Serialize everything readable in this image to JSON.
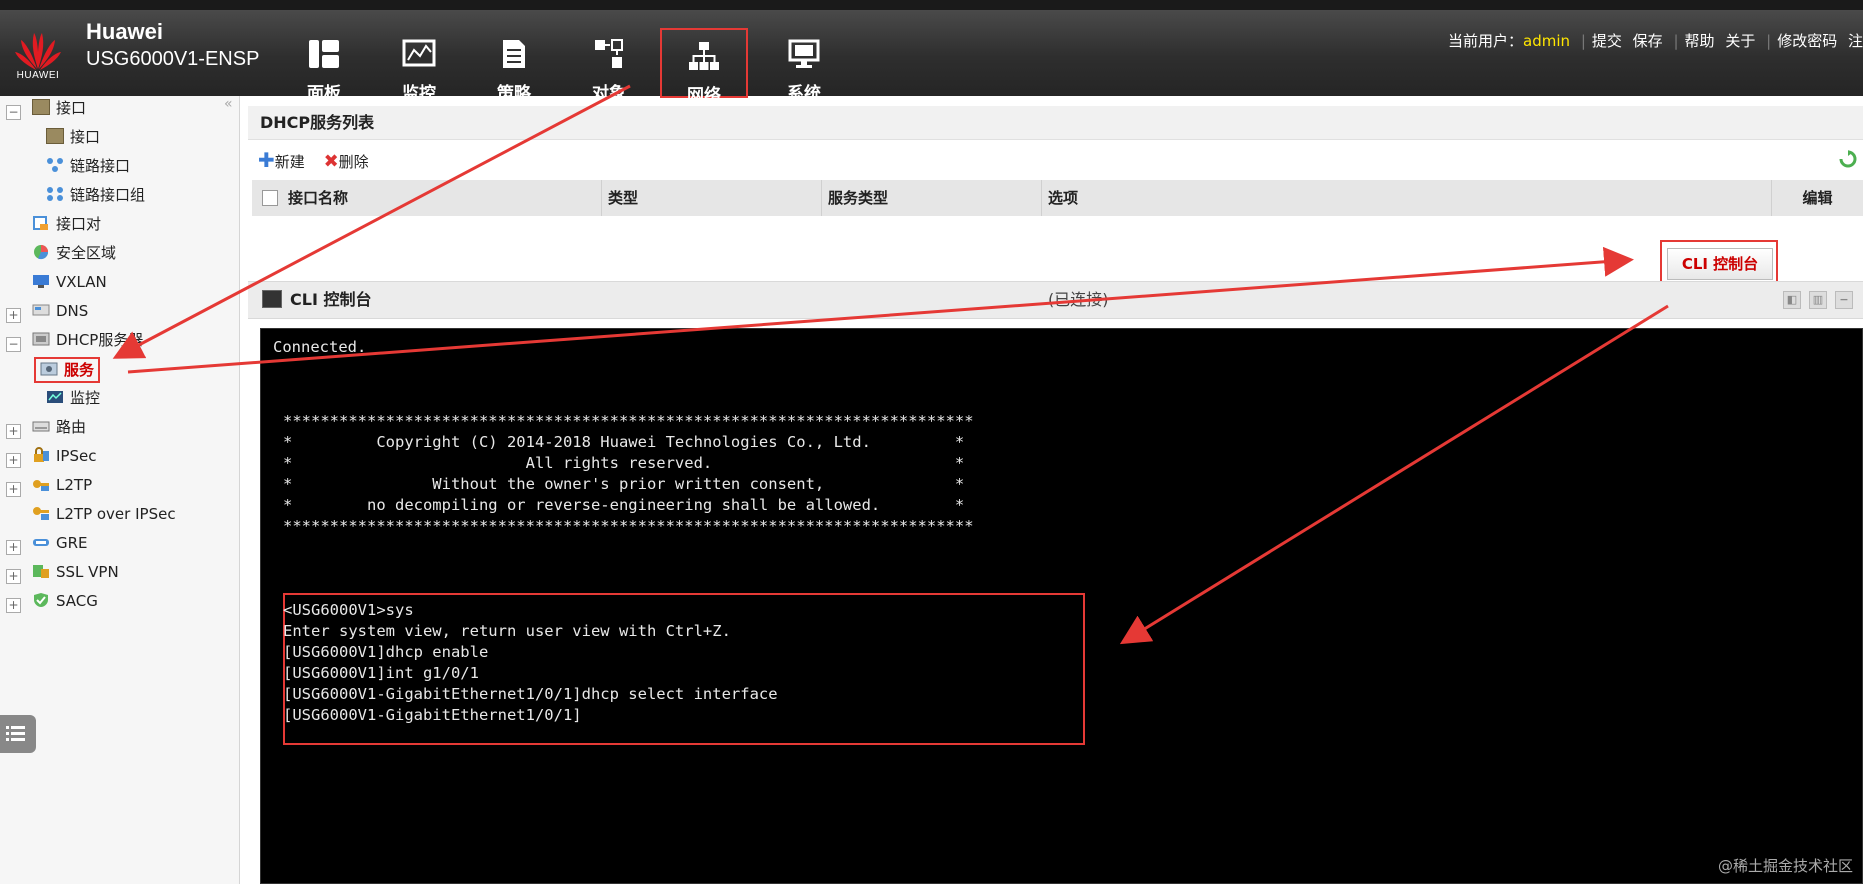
{
  "header": {
    "brand": "Huawei",
    "logo_text": "HUAWEI",
    "product": "USG6000V1-ENSP",
    "tabs": [
      {
        "label": "面板",
        "icon": "dashboard-icon"
      },
      {
        "label": "监控",
        "icon": "monitor-chart-icon"
      },
      {
        "label": "策略",
        "icon": "policy-document-icon"
      },
      {
        "label": "对象",
        "icon": "object-icon"
      },
      {
        "label": "网络",
        "icon": "network-icon",
        "active": true
      },
      {
        "label": "系统",
        "icon": "system-computer-icon"
      }
    ],
    "current_user_label": "当前用户：",
    "current_user": "admin",
    "links": [
      "提交",
      "保存",
      "帮助",
      "关于",
      "修改密码",
      "注"
    ]
  },
  "sidebar": {
    "items": [
      {
        "label": "接口",
        "icon": "interface-icon"
      },
      {
        "label": "接口",
        "icon": "interface-icon"
      },
      {
        "label": "链路接口",
        "icon": "link-interface-icon"
      },
      {
        "label": "链路接口组",
        "icon": "link-group-icon"
      },
      {
        "label": "接口对",
        "icon": "interface-pair-icon"
      },
      {
        "label": "安全区域",
        "icon": "security-zone-icon"
      },
      {
        "label": "VXLAN",
        "icon": "vxlan-icon"
      },
      {
        "label": "DNS",
        "icon": "dns-icon"
      },
      {
        "label": "DHCP服务器",
        "icon": "dhcp-server-icon"
      },
      {
        "label": "服务",
        "icon": "service-icon",
        "selected": true
      },
      {
        "label": "监控",
        "icon": "monitor-icon"
      },
      {
        "label": "路由",
        "icon": "route-icon"
      },
      {
        "label": "IPSec",
        "icon": "ipsec-icon"
      },
      {
        "label": "L2TP",
        "icon": "l2tp-icon"
      },
      {
        "label": "L2TP over IPSec",
        "icon": "l2tp-ipsec-icon"
      },
      {
        "label": "GRE",
        "icon": "gre-icon"
      },
      {
        "label": "SSL VPN",
        "icon": "ssl-vpn-icon"
      },
      {
        "label": "SACG",
        "icon": "sacg-shield-icon"
      }
    ]
  },
  "main": {
    "list_title": "DHCP服务列表",
    "toolbar": {
      "new": "新建",
      "delete": "删除"
    },
    "columns": [
      "接口名称",
      "类型",
      "服务类型",
      "选项",
      "编辑"
    ],
    "cli_button": "CLI 控制台"
  },
  "cli": {
    "title": "CLI 控制台",
    "status": "(已连接)",
    "lines": [
      "Connected.",
      "**************************************************************************",
      "*         Copyright (C) 2014-2018 Huawei Technologies Co., Ltd.         *",
      "*                         All rights reserved.                          *",
      "*               Without the owner's prior written consent,              *",
      "*        no decompiling or reverse-engineering shall be allowed.        *",
      "**************************************************************************",
      "<USG6000V1>sys",
      "Enter system view, return user view with Ctrl+Z.",
      "[USG6000V1]dhcp enable",
      "[USG6000V1]int g1/0/1",
      "[USG6000V1-GigabitEthernet1/0/1]dhcp select interface",
      "[USG6000V1-GigabitEthernet1/0/1]"
    ]
  },
  "watermark": "@稀土掘金技术社区",
  "colors": {
    "annotation": "#e53935",
    "user": "#ffe600",
    "header_bg": "#2e2e2e",
    "terminal_bg": "#000000"
  }
}
